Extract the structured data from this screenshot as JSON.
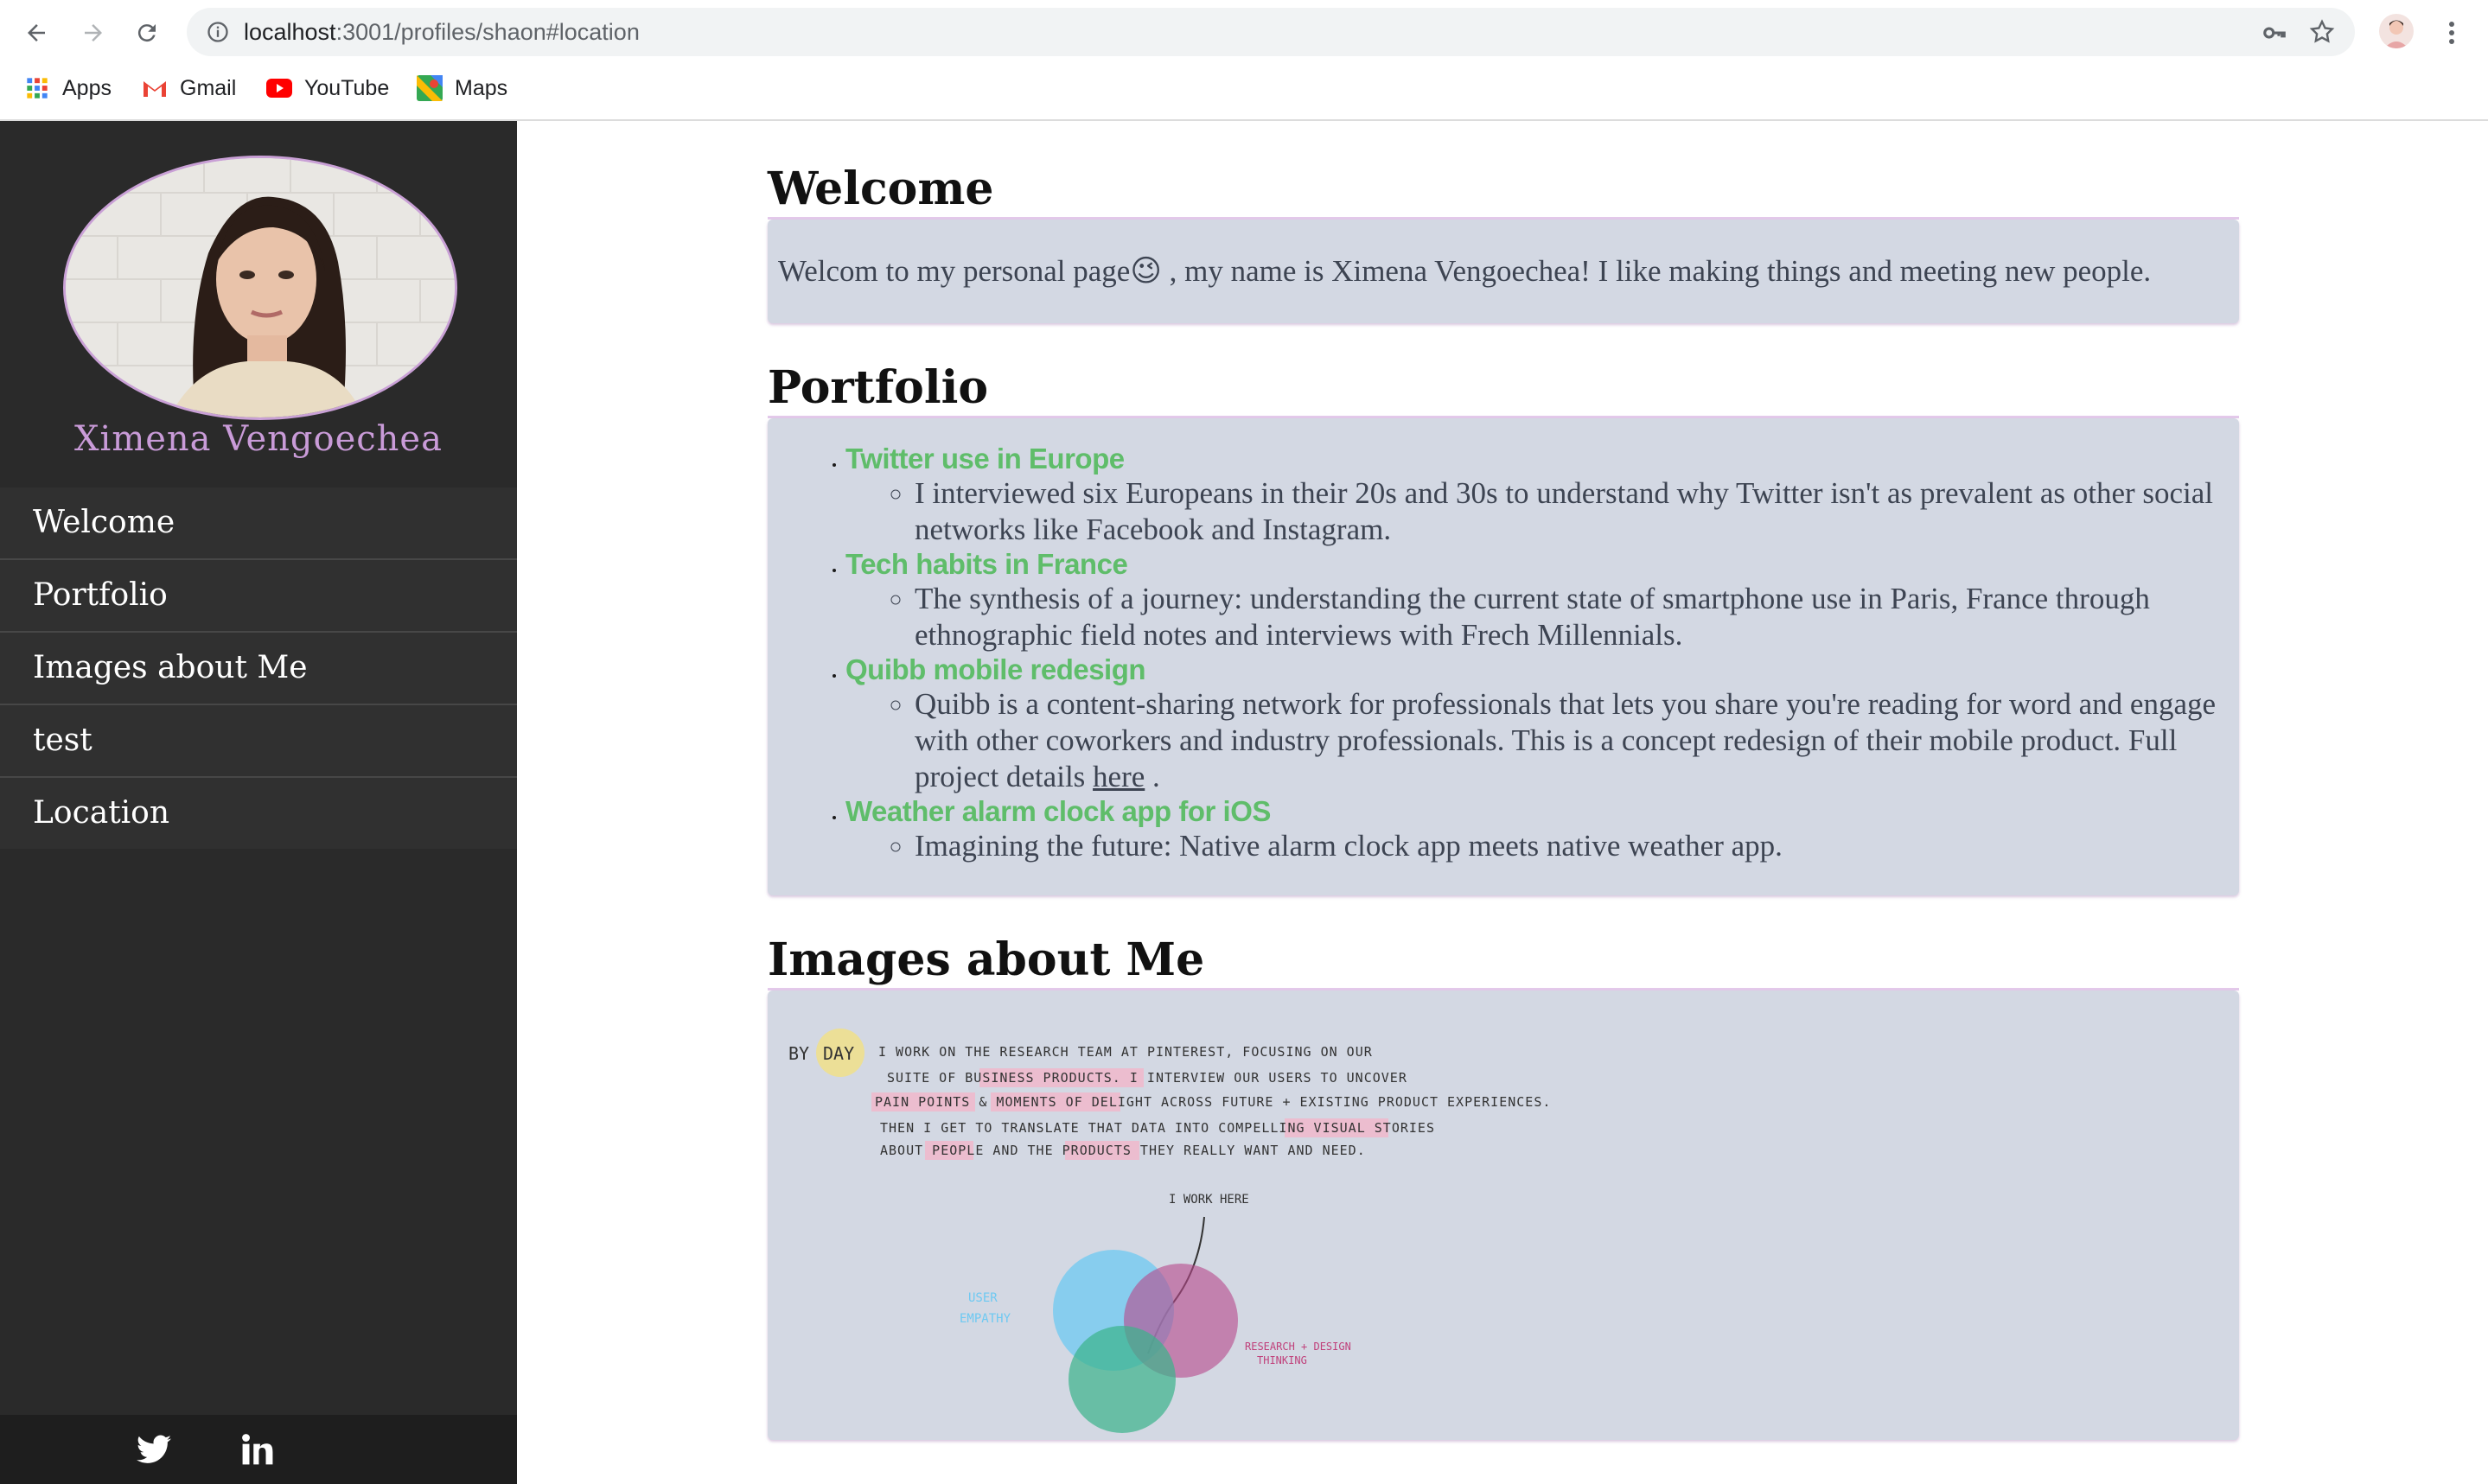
{
  "browser": {
    "url_host": "localhost",
    "url_path": ":3001/profiles/shaon#location",
    "bookmarks": [
      {
        "label": "Apps",
        "icon": "apps-grid-icon"
      },
      {
        "label": "Gmail",
        "icon": "gmail-icon"
      },
      {
        "label": "YouTube",
        "icon": "youtube-icon"
      },
      {
        "label": "Maps",
        "icon": "maps-icon"
      }
    ]
  },
  "sidebar": {
    "name": "Ximena  Vengoechea",
    "items": [
      {
        "label": "Welcome"
      },
      {
        "label": "Portfolio"
      },
      {
        "label": "Images about Me"
      },
      {
        "label": "test"
      },
      {
        "label": "Location"
      }
    ],
    "social": [
      "twitter-icon",
      "linkedin-icon"
    ]
  },
  "welcome": {
    "title": "Welcome",
    "text_before": "Welcom to my personal page",
    "emoji": "😉",
    "text_after": " , my name is Ximena Vengoechea! I like making things and meeting new people."
  },
  "portfolio": {
    "title": "Portfolio",
    "items": [
      {
        "title": "Twitter use in Europe",
        "desc": "I interviewed six Europeans in their 20s and 30s to understand why Twitter isn't as prevalent as other social networks like Facebook and Instagram."
      },
      {
        "title": "Tech habits in France",
        "desc": "The synthesis of a journey: understanding the current state of smartphone use in Paris, France through ethnographic field notes and interviews with Frech Millennials."
      },
      {
        "title": "Quibb mobile redesign",
        "desc": "Quibb is a content-sharing network for professionals that lets you share you're reading for word and engage with other coworkers and industry professionals. This is a concept redesign of their mobile product. Full project details ",
        "link": "here",
        "desc_after": " ."
      },
      {
        "title": "Weather alarm clock app for iOS",
        "desc": "Imagining the future: Native alarm clock app meets native weather app."
      }
    ]
  },
  "images": {
    "title": "Images about Me",
    "sketch": {
      "by": "BY",
      "day": "DAY",
      "lines": [
        "I WORK ON THE RESEARCH TEAM AT PINTEREST, FOCUSING ON OUR",
        "SUITE OF BUSINESS PRODUCTS. I INTERVIEW OUR USERS TO UNCOVER",
        "PAIN POINTS & MOMENTS OF DELIGHT ACROSS FUTURE + EXISTING PRODUCT EXPERIENCES.",
        "THEN I GET TO TRANSLATE THAT DATA INTO COMPELLING VISUAL STORIES",
        "ABOUT PEOPLE AND THE PRODUCTS THEY REALLY WANT AND NEED."
      ],
      "i_work_here": "I WORK HERE",
      "user_empathy": [
        "USER",
        "EMPATHY"
      ],
      "research_design": [
        "RESEARCH + DESIGN",
        "THINKING"
      ]
    }
  },
  "colors": {
    "sidebar_bg": "#2a2a2a",
    "name_accent": "#c99bd8",
    "panel_bg": "#d3d8e3",
    "link_green": "#5fbd6a"
  }
}
